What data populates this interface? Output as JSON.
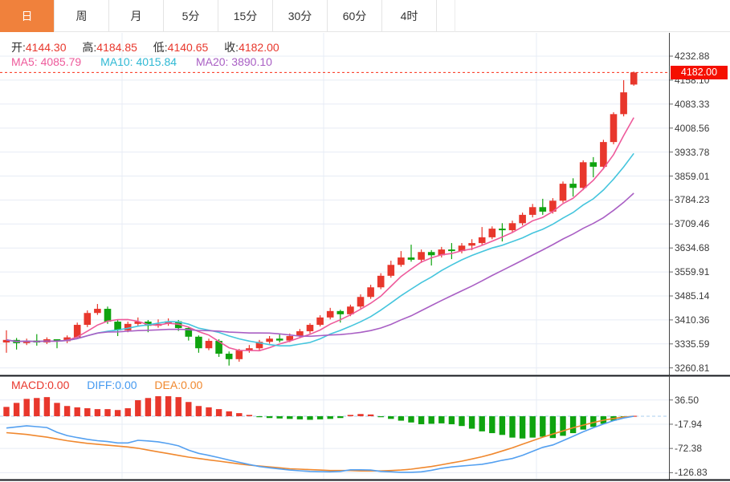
{
  "tabs": {
    "items": [
      {
        "label": "日",
        "active": true
      },
      {
        "label": "周",
        "active": false
      },
      {
        "label": "月",
        "active": false
      },
      {
        "label": "5分",
        "active": false
      },
      {
        "label": "15分",
        "active": false
      },
      {
        "label": "30分",
        "active": false
      },
      {
        "label": "60分",
        "active": false
      },
      {
        "label": "4时",
        "active": false
      }
    ]
  },
  "quote": {
    "open_label": "开:",
    "open_value": "4144.30",
    "high_label": "高:",
    "high_value": "4184.85",
    "low_label": "低:",
    "low_value": "4140.65",
    "close_label": "收:",
    "close_value": "4182.00"
  },
  "ma_header": {
    "ma5_label": "MA5:",
    "ma5_value": "4085.79",
    "ma10_label": "MA10:",
    "ma10_value": "4015.84",
    "ma20_label": "MA20:",
    "ma20_value": "3890.10"
  },
  "macd_header": {
    "macd_label": "MACD:",
    "macd_value": "0.00",
    "diff_label": "DIFF:",
    "diff_value": "0.00",
    "dea_label": "DEA:",
    "dea_value": "0.00"
  },
  "price_badge": {
    "value": "4182.00"
  },
  "colors": {
    "up": "#e8372c",
    "down": "#0fa30f",
    "ma5": "#ee5a9b",
    "ma10": "#45c5dd",
    "ma20": "#a95fc4",
    "diff_line": "#54a0f0",
    "dea_line": "#f0882e",
    "badge_bg": "#f50f00",
    "price_dash": "#fa2d14",
    "grid": "#e7ecf5",
    "axis": "#444444",
    "border": "#15181d",
    "tab_active_bg": "#f0813c",
    "zero_dash": "#a9cdec"
  },
  "chart_data": {
    "type": "candlestick",
    "panels": [
      "price",
      "macd"
    ],
    "y_axis_labels": [
      "4232.88",
      "4158.10",
      "4083.33",
      "4008.56",
      "3933.78",
      "3859.01",
      "3784.23",
      "3709.46",
      "3634.68",
      "3559.91",
      "3485.14",
      "3410.36",
      "3335.59",
      "3260.81"
    ],
    "y_axis_top": 4232.88,
    "y_axis_step": 74.775,
    "current_price": 4182.0,
    "ma_windows": [
      5,
      10,
      20
    ],
    "candles": {
      "open": [
        3340,
        3348,
        3338,
        3346,
        3340,
        3350,
        3344,
        3356,
        3395,
        3432,
        3445,
        3405,
        3378,
        3398,
        3405,
        3392,
        3398,
        3406,
        3385,
        3358,
        3322,
        3345,
        3305,
        3288,
        3315,
        3322,
        3342,
        3352,
        3346,
        3360,
        3375,
        3395,
        3418,
        3438,
        3428,
        3452,
        3482,
        3512,
        3548,
        3582,
        3605,
        3598,
        3622,
        3612,
        3630,
        3625,
        3642,
        3650,
        3668,
        3695,
        3690,
        3712,
        3738,
        3762,
        3748,
        3782,
        3835,
        3822,
        3902,
        3888,
        3965,
        4052,
        4144.3
      ],
      "close": [
        3348,
        3338,
        3346,
        3340,
        3350,
        3344,
        3356,
        3395,
        3432,
        3445,
        3405,
        3378,
        3398,
        3405,
        3392,
        3398,
        3406,
        3385,
        3358,
        3322,
        3345,
        3305,
        3288,
        3315,
        3322,
        3342,
        3352,
        3346,
        3360,
        3375,
        3395,
        3418,
        3438,
        3428,
        3452,
        3482,
        3512,
        3548,
        3582,
        3605,
        3598,
        3622,
        3612,
        3630,
        3625,
        3642,
        3650,
        3668,
        3695,
        3690,
        3712,
        3738,
        3762,
        3748,
        3782,
        3835,
        3822,
        3902,
        3888,
        3965,
        4052,
        4120,
        4182
      ],
      "high": [
        3378,
        3354,
        3352,
        3366,
        3356,
        3350,
        3362,
        3402,
        3440,
        3460,
        3452,
        3412,
        3405,
        3418,
        3410,
        3412,
        3415,
        3410,
        3390,
        3362,
        3352,
        3350,
        3312,
        3320,
        3332,
        3348,
        3360,
        3365,
        3368,
        3382,
        3400,
        3425,
        3448,
        3442,
        3458,
        3490,
        3520,
        3556,
        3595,
        3625,
        3645,
        3630,
        3628,
        3638,
        3650,
        3650,
        3662,
        3700,
        3702,
        3712,
        3720,
        3745,
        3772,
        3788,
        3790,
        3842,
        3852,
        3908,
        3918,
        3972,
        4058,
        4158,
        4184.85
      ],
      "low": [
        3308,
        3318,
        3332,
        3330,
        3335,
        3322,
        3338,
        3350,
        3388,
        3426,
        3398,
        3360,
        3372,
        3392,
        3372,
        3386,
        3392,
        3376,
        3346,
        3308,
        3316,
        3295,
        3268,
        3280,
        3308,
        3315,
        3336,
        3340,
        3341,
        3354,
        3368,
        3390,
        3412,
        3402,
        3422,
        3446,
        3476,
        3506,
        3542,
        3576,
        3592,
        3588,
        3580,
        3605,
        3600,
        3618,
        3628,
        3645,
        3662,
        3655,
        3682,
        3705,
        3730,
        3738,
        3742,
        3776,
        3795,
        3815,
        3855,
        3880,
        3958,
        4045,
        4140.65
      ]
    },
    "macd": {
      "y_axis_labels": [
        "36.50",
        "-17.94",
        "-72.38",
        "-126.83"
      ],
      "y_axis_values": [
        36.5,
        -17.94,
        -72.38,
        -126.83
      ],
      "hist": [
        21,
        30,
        39,
        41,
        43,
        30,
        23,
        20,
        18,
        16,
        16,
        14,
        18,
        36,
        41,
        45,
        45,
        43,
        32,
        23,
        20,
        16,
        11,
        7,
        3,
        -2,
        -4,
        -5,
        -6,
        -7,
        -8,
        -7,
        -6,
        -4,
        3,
        5,
        4,
        -2,
        -6,
        -10,
        -14,
        -18,
        -17,
        -16,
        -18,
        -22,
        -28,
        -34,
        -38,
        -42,
        -48,
        -50,
        -48,
        -46,
        -49,
        -44,
        -38,
        -30,
        -24,
        -17,
        -10,
        -4,
        1
      ],
      "diff": [
        -26.5,
        -24,
        -21.5,
        -23.5,
        -25.5,
        -36,
        -43.5,
        -48,
        -52,
        -55,
        -57,
        -60,
        -60,
        -54,
        -55.5,
        -57.5,
        -61.5,
        -66.5,
        -76,
        -83.5,
        -88,
        -93,
        -98.5,
        -103.5,
        -108.5,
        -113,
        -116,
        -118.5,
        -121,
        -122.5,
        -124,
        -124.5,
        -125,
        -124,
        -120.5,
        -120.5,
        -121,
        -124,
        -125,
        -126,
        -126,
        -125,
        -121.5,
        -117,
        -114,
        -112,
        -110,
        -108,
        -104,
        -99,
        -95,
        -88,
        -79,
        -70,
        -64.5,
        -55,
        -45,
        -35,
        -26,
        -17.5,
        -10,
        -4,
        0
      ],
      "dea": [
        -37,
        -39,
        -41,
        -44,
        -47,
        -51,
        -55,
        -58,
        -61,
        -63,
        -65,
        -67,
        -69,
        -72,
        -76,
        -80,
        -84,
        -88,
        -92,
        -95,
        -98,
        -101,
        -104,
        -107,
        -110,
        -112,
        -114,
        -116,
        -118,
        -119,
        -120,
        -121,
        -122,
        -122,
        -122,
        -123,
        -123,
        -123,
        -122,
        -121,
        -119,
        -116,
        -113,
        -109,
        -105,
        -101,
        -96,
        -91,
        -85,
        -78,
        -71,
        -63,
        -55,
        -47,
        -40,
        -33,
        -26,
        -20,
        -14,
        -9,
        -5,
        -2,
        0
      ]
    }
  }
}
